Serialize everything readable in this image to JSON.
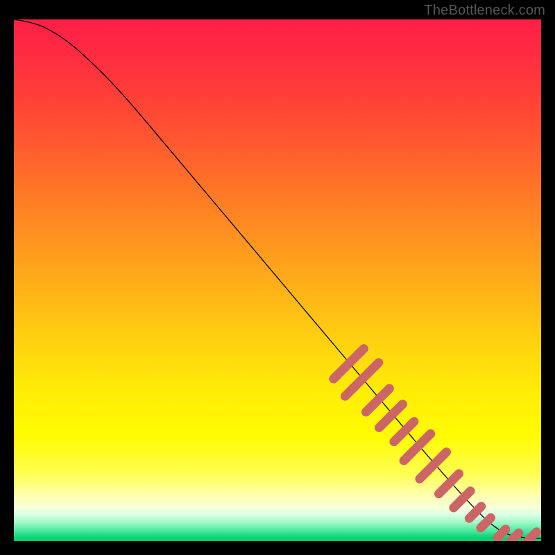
{
  "watermark": "TheBottleneck.com",
  "chart_data": {
    "type": "line",
    "title": "",
    "xlabel": "",
    "ylabel": "",
    "xlim": [
      0,
      100
    ],
    "ylim": [
      0,
      100
    ],
    "grid": false,
    "legend": null,
    "curve": [
      {
        "x": 0,
        "y": 100
      },
      {
        "x": 3,
        "y": 99.5
      },
      {
        "x": 6,
        "y": 98.5
      },
      {
        "x": 10,
        "y": 96
      },
      {
        "x": 14,
        "y": 92.5
      },
      {
        "x": 20,
        "y": 86.5
      },
      {
        "x": 30,
        "y": 74.5
      },
      {
        "x": 40,
        "y": 62.5
      },
      {
        "x": 50,
        "y": 50.5
      },
      {
        "x": 60,
        "y": 38.5
      },
      {
        "x": 70,
        "y": 26.5
      },
      {
        "x": 80,
        "y": 14.5
      },
      {
        "x": 88,
        "y": 5.5
      },
      {
        "x": 92,
        "y": 2.0
      },
      {
        "x": 95,
        "y": 0.8
      },
      {
        "x": 100,
        "y": 0.5
      }
    ],
    "markers": [
      {
        "x": 63.5,
        "y": 34.0,
        "len": 4.5
      },
      {
        "x": 66.0,
        "y": 31.0,
        "len": 5.0
      },
      {
        "x": 69.0,
        "y": 27.0,
        "len": 3.5
      },
      {
        "x": 71.5,
        "y": 24.0,
        "len": 3.5
      },
      {
        "x": 74.0,
        "y": 21.0,
        "len": 3.0
      },
      {
        "x": 76.5,
        "y": 18.0,
        "len": 4.0
      },
      {
        "x": 79.5,
        "y": 14.5,
        "len": 4.0
      },
      {
        "x": 82.5,
        "y": 11.0,
        "len": 3.0
      },
      {
        "x": 85.0,
        "y": 8.0,
        "len": 2.5
      },
      {
        "x": 87.5,
        "y": 5.5,
        "len": 1.8
      },
      {
        "x": 89.5,
        "y": 3.5,
        "len": 1.5
      },
      {
        "x": 92.5,
        "y": 1.5,
        "len": 1.2
      },
      {
        "x": 95.0,
        "y": 0.8,
        "len": 1.2
      },
      {
        "x": 98.0,
        "y": 0.6,
        "len": 1.8
      }
    ],
    "marker_color": "#cc6666"
  }
}
